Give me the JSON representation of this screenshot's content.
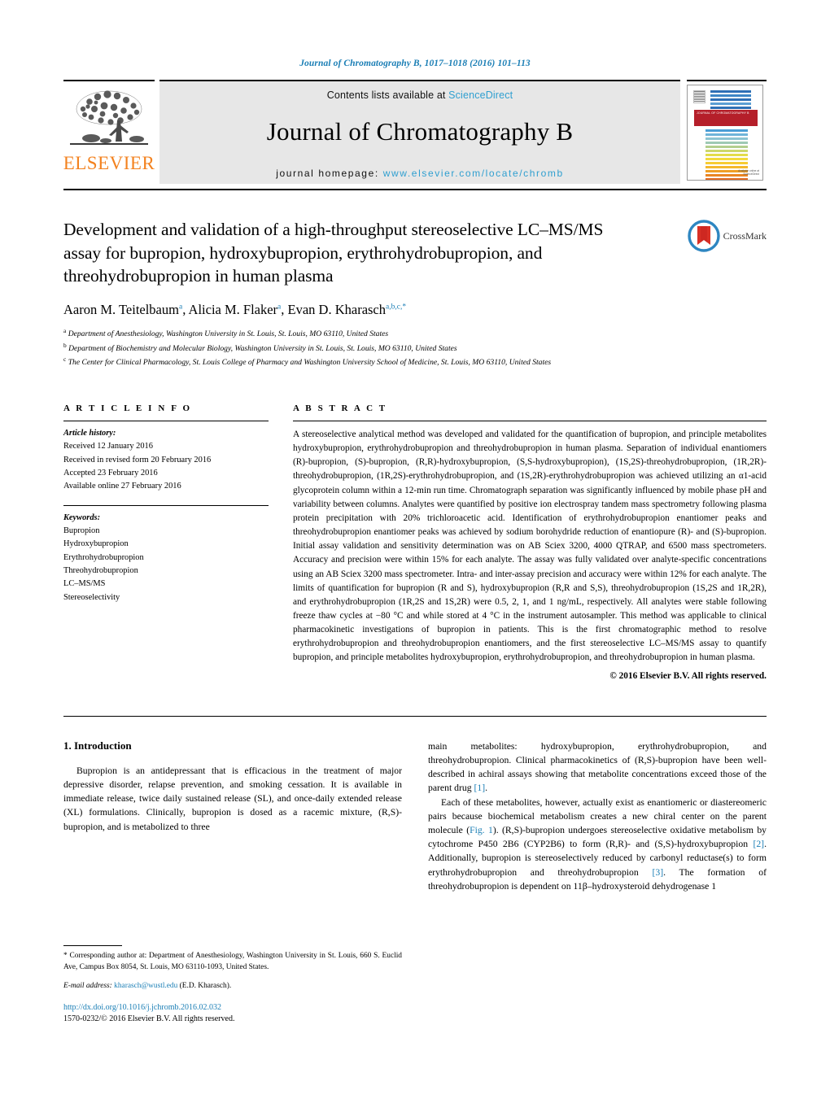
{
  "running_head": "Journal of Chromatography B, 1017–1018 (2016) 101–113",
  "masthead": {
    "contents_prefix": "Contents lists available at ",
    "sciencedirect": "ScienceDirect",
    "journal_title": "Journal of Chromatography B",
    "homepage_prefix": "journal homepage:",
    "homepage_url": "www.elsevier.com/locate/chromb",
    "publisher": "ELSEVIER",
    "cover_banner": "JOURNAL OF CHROMATOGRAPHY B",
    "cover_banner_sub": "Analytical Technologies in the Biomedical and Life Sciences",
    "cover_footer": "Available online at ScienceDirect",
    "accent_link_color": "#2f9fd0",
    "elsevier_orange": "#f3821f",
    "cover_red": "#b51f2a"
  },
  "article": {
    "title": "Development and validation of a high-throughput stereoselective LC–MS/MS assay for bupropion, hydroxybupropion, erythrohydrobupropion, and threohydrobupropion in human plasma",
    "crossmark_label": "CrossMark",
    "authors": [
      {
        "name": "Aaron M. Teitelbaum",
        "marks": "a"
      },
      {
        "name": "Alicia M. Flaker",
        "marks": "a"
      },
      {
        "name": "Evan D. Kharasch",
        "marks": "a,b,c,*"
      }
    ],
    "affiliations": [
      {
        "mark": "a",
        "text": "Department of Anesthesiology, Washington University in St. Louis, St. Louis, MO 63110, United States"
      },
      {
        "mark": "b",
        "text": "Department of Biochemistry and Molecular Biology, Washington University in St. Louis, St. Louis, MO 63110, United States"
      },
      {
        "mark": "c",
        "text": "The Center for Clinical Pharmacology, St. Louis College of Pharmacy and Washington University School of Medicine, St. Louis, MO 63110, United States"
      }
    ]
  },
  "article_info": {
    "heading": "A R T I C L E   I N F O",
    "history_label": "Article history:",
    "history": [
      "Received 12 January 2016",
      "Received in revised form 20 February 2016",
      "Accepted 23 February 2016",
      "Available online 27 February 2016"
    ],
    "keywords_label": "Keywords:",
    "keywords": [
      "Bupropion",
      "Hydroxybupropion",
      "Erythrohydrobupropion",
      "Threohydrobupropion",
      "LC–MS/MS",
      "Stereoselectivity"
    ]
  },
  "abstract": {
    "heading": "A B S T R A C T",
    "text": "A stereoselective analytical method was developed and validated for the quantification of bupropion, and principle metabolites hydroxybupropion, erythrohydrobupropion and threohydrobupropion in human plasma. Separation of individual enantiomers (R)-bupropion, (S)-bupropion, (R,R)-hydroxybupropion, (S,S-hydroxybupropion), (1S,2S)-threohydrobupropion, (1R,2R)-threohydrobupropion, (1R,2S)-erythrohydrobupropion, and (1S,2R)-erythrohydrobupropion was achieved utilizing an α1-acid glycoprotein column within a 12-min run time. Chromatograph separation was significantly influenced by mobile phase pH and variability between columns. Analytes were quantified by positive ion electrospray tandem mass spectrometry following plasma protein precipitation with 20% trichloroacetic acid. Identification of erythrohydrobupropion enantiomer peaks and threohydrobupropion enantiomer peaks was achieved by sodium borohydride reduction of enantiopure (R)- and (S)-bupropion. Initial assay validation and sensitivity determination was on AB Sciex 3200, 4000 QTRAP, and 6500 mass spectrometers. Accuracy and precision were within 15% for each analyte. The assay was fully validated over analyte-specific concentrations using an AB Sciex 3200 mass spectrometer. Intra- and inter-assay precision and accuracy were within 12% for each analyte. The limits of quantification for bupropion (R and S), hydroxybupropion (R,R and S,S), threohydrobupropion (1S,2S and 1R,2R), and erythrohydrobupropion (1R,2S and 1S,2R) were 0.5, 2, 1, and 1 ng/mL, respectively. All analytes were stable following freeze thaw cycles at −80 °C and while stored at 4 °C in the instrument autosampler. This method was applicable to clinical pharmacokinetic investigations of bupropion in patients. This is the first chromatographic method to resolve erythrohydrobupropion and threohydrobupropion enantiomers, and the first stereoselective LC–MS/MS assay to quantify bupropion, and principle metabolites hydroxybupropion, erythrohydrobupropion, and threohydrobupropion in human plasma.",
    "copyright": "© 2016 Elsevier B.V. All rights reserved."
  },
  "introduction": {
    "heading": "1.  Introduction",
    "para1_left": "Bupropion is an antidepressant that is efficacious in the treatment of major depressive disorder, relapse prevention, and smoking cessation. It is available in immediate release, twice daily sustained release (SL), and once-daily extended release (XL) formulations. Clinically, bupropion is dosed as a racemic mixture, (R,S)-bupropion, and is metabolized to three",
    "para1_right_cont": "main metabolites: hydroxybupropion, erythrohydrobupropion, and threohydrobupropion. Clinical pharmacokinetics of (R,S)-bupropion have been well-described in achiral assays showing that metabolite concentrations exceed those of the parent drug ",
    "ref1": "[1]",
    "para2_a": "Each of these metabolites, however, actually exist as enantiomeric or diastereomeric pairs because biochemical metabolism creates a new chiral center on the parent molecule (",
    "fig1_ref": "Fig. 1",
    "para2_b": "). (R,S)-bupropion undergoes stereoselective oxidative metabolism by cytochrome P450 2B6 (CYP2B6) to form (R,R)- and (S,S)-hydroxybupropion ",
    "ref2": "[2]",
    "para2_c": ". Additionally, bupropion is stereoselectively reduced by carbonyl reductase(s) to form erythrohydrobupropion and threohydrobupropion ",
    "ref3": "[3]",
    "para2_d": ". The formation of threohydrobupropion is dependent on 11β–hydroxysteroid dehydrogenase 1"
  },
  "footer": {
    "corresponding": "* Corresponding author at: Department of Anesthesiology, Washington University in St. Louis, 660 S. Euclid Ave, Campus Box 8054, St. Louis, MO 63110-1093, United States.",
    "email_label": "E-mail address:",
    "email": "kharasch@wustl.edu",
    "email_owner": "(E.D. Kharasch).",
    "doi": "http://dx.doi.org/10.1016/j.jchromb.2016.02.032",
    "issn_line": "1570-0232/© 2016 Elsevier B.V. All rights reserved."
  }
}
